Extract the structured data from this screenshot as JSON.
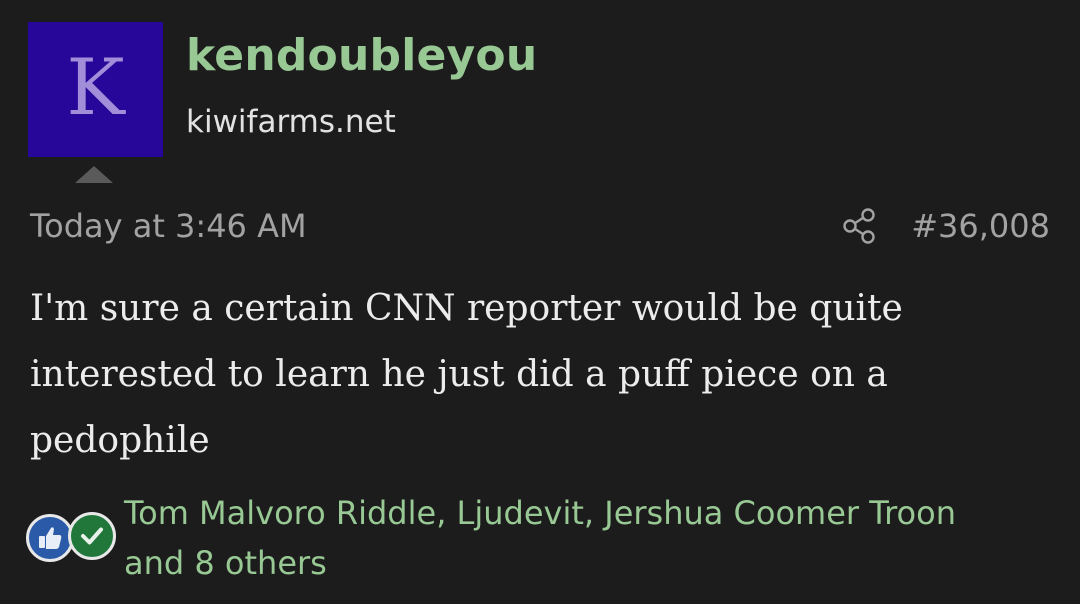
{
  "post": {
    "avatar_letter": "K",
    "username": "kendoubleyou",
    "site": "kiwifarms.net",
    "timestamp": "Today at 3:46 AM",
    "post_number": "#36,008",
    "body": "I'm sure a certain CNN reporter would be quite interested to learn he just did a puff piece on a pedophile"
  },
  "reactions": {
    "icons": [
      "thumbs-up-icon",
      "checkmark-icon"
    ],
    "users_line1": "Tom Malvoro Riddle, Ljudevit, Jershua Coomer Troon",
    "users_line2": "and 8 others"
  },
  "colors": {
    "background": "#1c1c1c",
    "avatar_bg": "#26079a",
    "username": "#98c894",
    "reaction_text": "#98c894",
    "like": "#2a5aa8",
    "agree": "#21773a"
  }
}
